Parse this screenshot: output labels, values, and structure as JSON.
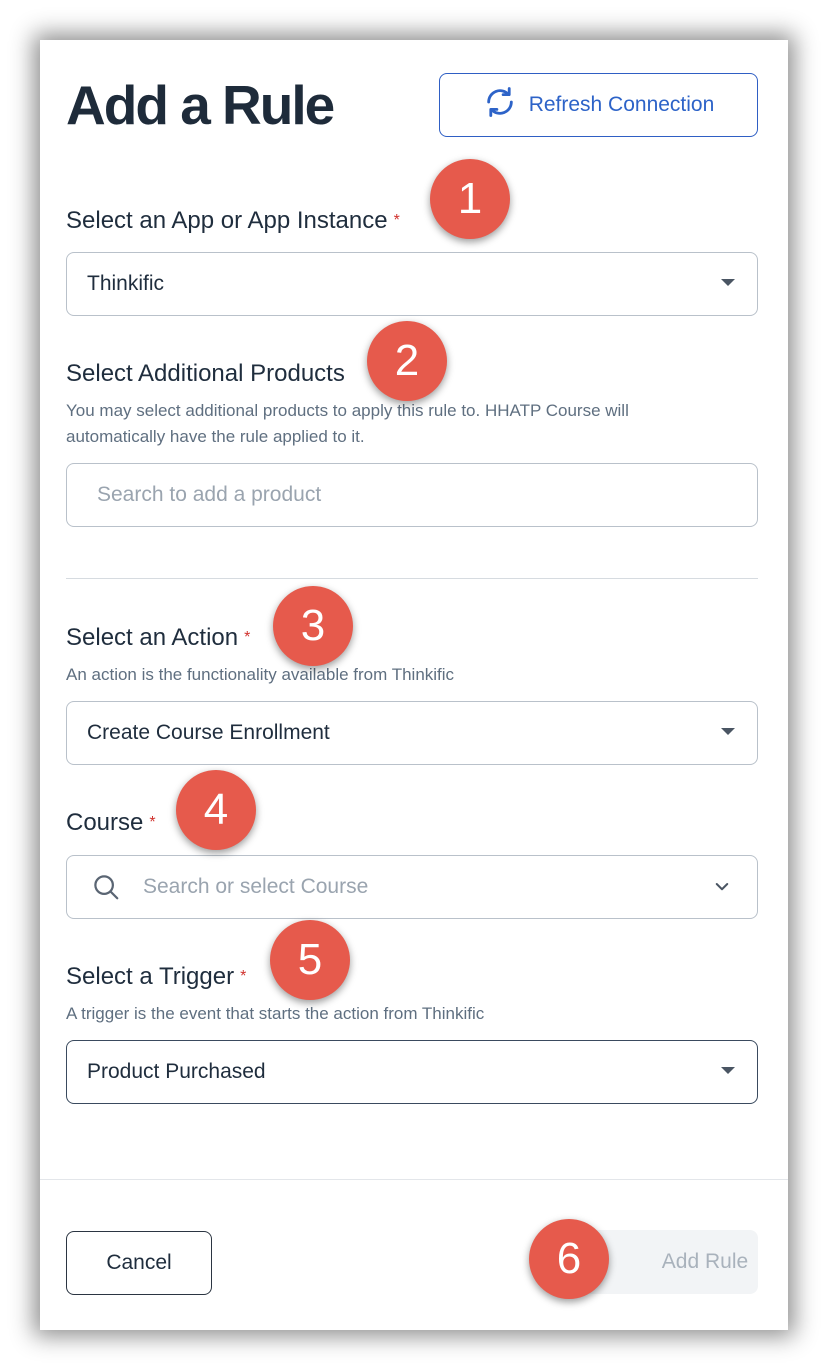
{
  "modal": {
    "title": "Add a Rule",
    "refresh_label": "Refresh Connection",
    "required_mark": "*",
    "app": {
      "label": "Select an App or App Instance",
      "value": "Thinkific"
    },
    "products": {
      "label": "Select Additional Products",
      "hint": "You may select additional products to apply this rule to. HHATP Course will automatically have the rule applied to it.",
      "placeholder": "Search to add a product"
    },
    "action": {
      "label": "Select an Action",
      "hint": "An action is the functionality available from Thinkific",
      "value": "Create Course Enrollment"
    },
    "course": {
      "label": "Course",
      "placeholder": "Search or select Course"
    },
    "trigger": {
      "label": "Select a Trigger",
      "hint": "A trigger is the event that starts the action from Thinkific",
      "value": "Product Purchased"
    },
    "cancel_label": "Cancel",
    "add_label": "Add Rule"
  },
  "annotations": [
    "1",
    "2",
    "3",
    "4",
    "5",
    "6"
  ],
  "colors": {
    "accent": "#2d63c8",
    "required": "#d0312d",
    "badge": "#e65a4c"
  }
}
